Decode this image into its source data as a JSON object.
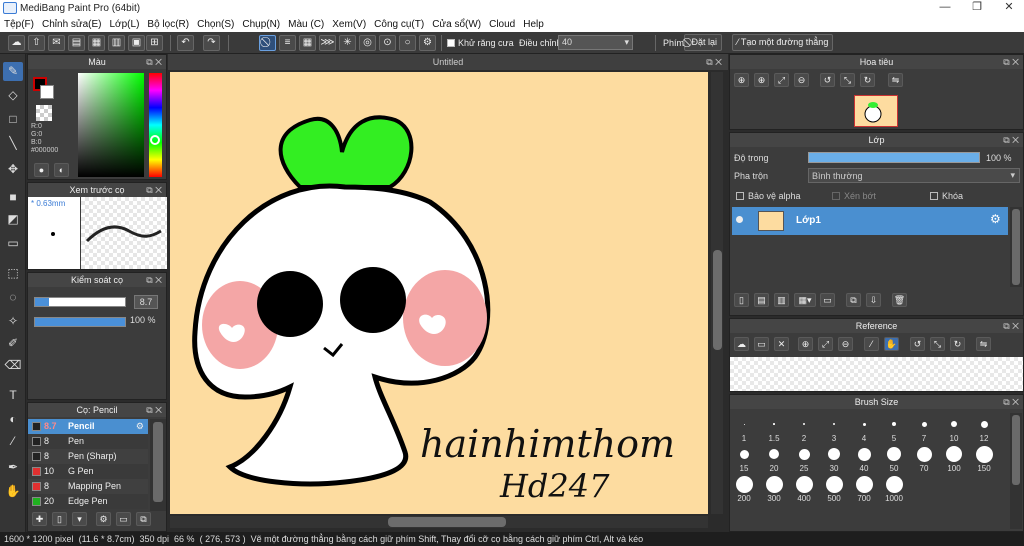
{
  "window": {
    "title": "MediBang Paint Pro (64bit)",
    "minimize": "—",
    "maximize": "❐",
    "close": "✕"
  },
  "menu": [
    "Tệp(F)",
    "Chỉnh sửa(E)",
    "Lớp(L)",
    "Bộ lọc(R)",
    "Chọn(S)",
    "Chụp(N)",
    "Màu (C)",
    "Xem(V)",
    "Công cụ(T)",
    "Cửa sổ(W)",
    "Cloud",
    "Help"
  ],
  "toolbar": {
    "antialias_label": "Khử răng cưa",
    "adjust_label": "Điều chỉnh",
    "adjust_value": "40",
    "brush_label": "Phím",
    "reset_label": "Đặt lại",
    "line_label": "Tạo một đường thẳng"
  },
  "color_panel": {
    "title": "Màu",
    "r": "R:0",
    "g": "G:0",
    "b": "B:0",
    "hex": "#000000"
  },
  "brush_preview": {
    "title": "Xem trước cọ",
    "size": "0.63mm"
  },
  "brush_control": {
    "title": "Kiểm soát cọ",
    "size_value": "8.7",
    "opacity_value": "100 %"
  },
  "brush_list": {
    "title": "Cọ: Pencil",
    "items": [
      {
        "size": "8.7",
        "name": "Pencil",
        "color": "#222222",
        "selected": true
      },
      {
        "size": "8",
        "name": "Pen",
        "color": "#222222",
        "selected": false
      },
      {
        "size": "8",
        "name": "Pen (Sharp)",
        "color": "#222222",
        "selected": false
      },
      {
        "size": "10",
        "name": "G Pen",
        "color": "#e03030",
        "selected": false
      },
      {
        "size": "8",
        "name": "Mapping Pen",
        "color": "#e03030",
        "selected": false
      },
      {
        "size": "20",
        "name": "Edge Pen",
        "color": "#20b020",
        "selected": false
      }
    ]
  },
  "document": {
    "tab_title": "Untitled"
  },
  "navigator": {
    "title": "Hoa tiêu"
  },
  "layer_panel": {
    "title": "Lớp",
    "opacity_label": "Độ trong",
    "opacity_value": "100 %",
    "blend_label": "Pha trộn",
    "blend_value": "Bình thường",
    "protect_alpha": "Bảo vệ alpha",
    "clipping": "Xén bớt",
    "lock": "Khóa",
    "layers": [
      {
        "name": "Lớp1"
      }
    ]
  },
  "reference_panel": {
    "title": "Reference"
  },
  "brush_size_panel": {
    "title": "Brush Size",
    "sizes": [
      "1",
      "1.5",
      "2",
      "3",
      "4",
      "5",
      "7",
      "10",
      "12",
      "15",
      "20",
      "25",
      "30",
      "40",
      "50",
      "70",
      "100",
      "150",
      "200",
      "300",
      "400",
      "500",
      "700",
      "1000"
    ]
  },
  "status": {
    "dimensions": "1600 * 1200 pixel",
    "physical": "(11.6 * 8.7cm)",
    "dpi": "350 dpi",
    "zoom": "66 %",
    "coords": "( 276, 573 )",
    "hint": "Vẽ một đường thẳng bằng cách giữ phím Shift, Thay đổi cỡ cọ bằng cách giữ phím Ctrl, Alt và kéo"
  },
  "artwork": {
    "signature_line1": "hainhimthom",
    "signature_line2": "Hd247"
  },
  "colors": {
    "accent": "#4a90d9",
    "canvas_bg": "#fddca0",
    "selected_brush_text": "#ff8a8a"
  }
}
